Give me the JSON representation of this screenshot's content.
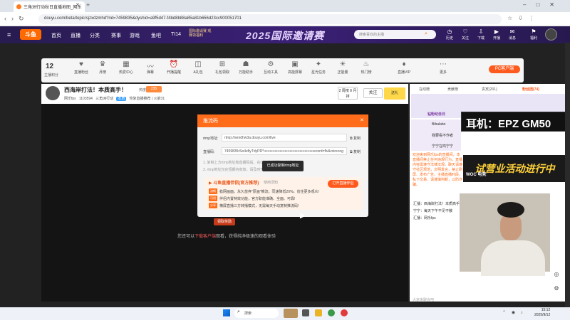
{
  "browser": {
    "tab_title": "三角洲行动秋日直播地图_网乐",
    "url": "douyu.com/beta/topic/sjzxdzmhd?rid=7459835&dyshid=a9f5d47-f4bd8b88a85a81b656d23cc900051701"
  },
  "topnav": {
    "logo": "斗鱼",
    "items": [
      "首页",
      "直播",
      "分类",
      "赛事",
      "游戏",
      "鱼吧",
      "TI14"
    ],
    "promo": "国际邀请赛 观赛领福利",
    "banner": "2025国际邀请赛",
    "search_placeholder": "搜索喜欢的主播",
    "right_labels": [
      "历史",
      "关注",
      "下载",
      "开播",
      "消息",
      "福利"
    ]
  },
  "categories": {
    "level": "12",
    "level_label": "主播积分",
    "items": [
      "直播粉丝",
      "月榜",
      "热爱中心",
      "弹幕",
      "开播提醒",
      "A礼包",
      "礼包领取",
      "万能助手",
      "互动工具",
      "高能屏幕",
      "星光任务",
      "正能量",
      "热门榜",
      "直播VIP",
      "更多"
    ],
    "pc_button": "PC客户端"
  },
  "room": {
    "title": "西海岸打法！本质高手！",
    "hot_label": "热度",
    "hot_value": "235",
    "host": "网乐fps",
    "room_id": "1103594",
    "game": "三角洲行动",
    "tag": "本质",
    "meta_extra": "恢复直播推荐 | 火箭31",
    "rank": "2 周榜 8 月排",
    "follow": "关注",
    "gift": "送礼"
  },
  "behind": {
    "button": "领取奖励",
    "text_pre": "您还可以",
    "text_link": "下载客户端",
    "text_post": "观看，获得纯净极速的观看体验"
  },
  "modal": {
    "title": "推流码",
    "rtmp_label": "rtmp地址:",
    "rtmp_value": "rtmp://sendhw3a.douyu.com/live",
    "code_label": "直播码:",
    "code_value": "7459835rSo4v8yTdyPR*••••••••••••••••••••••••••••••••••••••••ecord=flv&roirecog",
    "copy": "复制",
    "hint1": "1. 复制上方rtmp地址和直播码后，在OBS中设置并开始推流。",
    "hint2": "2. rtmp地址仅在短期内有效，请及时开播，有效期5分钟。",
    "toast": "已成功复制rtmp地址"
  },
  "promo": {
    "title": "斗鱼直播伴侣(官方推荐)",
    "subtitle": "使用须知",
    "button": "打开直播伴侣",
    "rows": [
      {
        "tag": "流畅",
        "text": "稳网画面，永久放弃\"原画\"推流，同速降低20%，省住更多观众!"
      },
      {
        "tag": "可用",
        "text": "伴侣内置特效功能，官方职能准确、全面、可靠!"
      },
      {
        "tag": "分享",
        "text": "横屏直播三方转播模式，无需每天手动复制推流码!"
      }
    ]
  },
  "chat": {
    "tabs": [
      "在线榜",
      "贡献榜",
      "贵宾(201)",
      "粉丝团(74)"
    ],
    "header_title": "钻粉纪念日",
    "fans": [
      "Bibalabo",
      "我要看不作者",
      "宁宁在鸣宁宁"
    ],
    "rank_label": "耳机：EPZ GM50",
    "notice": "欢迎来到网乐fps的直播间，本直播间禁止任何违规行为，直播内容需遵守法律法规。聊天请遵守社区规范，文明发言，禁止刷屏、发布广告。主播直播时段，私下交易、请谨慎判断，以防诈骗。",
    "ad_text": "试营业活动进行中",
    "ad_sub": "WOC 电竞",
    "messages": [
      "汇播：西海岸打法！本质高手！",
      "宁宁：每天下午不见不散",
      "汇播：网乐fps"
    ],
    "input_placeholder": "大家来聊会吧"
  },
  "taskbar": {
    "search": "搜索",
    "time": "15:12",
    "date": "2025/9/12"
  },
  "colors": {
    "accent": "#ff6c1a",
    "nav_bg": "#2a1c5a"
  }
}
